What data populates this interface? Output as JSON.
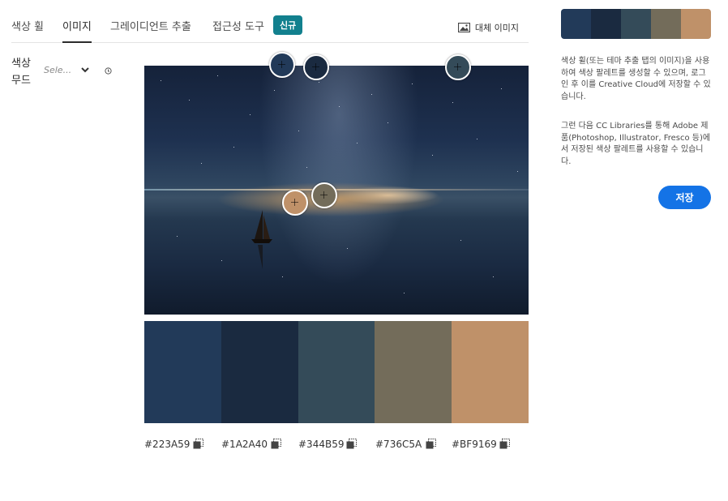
{
  "tabs": [
    {
      "label": "색상 휠"
    },
    {
      "label": "이미지"
    },
    {
      "label": "그레이디언트 추출"
    },
    {
      "label": "접근성 도구"
    }
  ],
  "new_badge": "신규",
  "alt_image_label": "대체 이미지",
  "color_mood": {
    "label": "색상 무드",
    "selected": "Sele..."
  },
  "palette": [
    {
      "hex": "#223A59"
    },
    {
      "hex": "#1A2A40"
    },
    {
      "hex": "#344B59"
    },
    {
      "hex": "#736C5A"
    },
    {
      "hex": "#BF9169"
    }
  ],
  "side_panel": {
    "paragraph1": "색상 휠(또는 테마 추출 탭의 이미지)을 사용하여 색상 팔레트를 생성할 수 있으며, 로그인 후 이를 Creative Cloud에 저장할 수 있습니다.",
    "paragraph2": "그런 다음 CC Libraries를 통해 Adobe 제품(Photoshop, Illustrator, Fresco 등)에서 저장된 색상 팔레트를 사용할 수 있습니다.",
    "save_label": "저장"
  }
}
